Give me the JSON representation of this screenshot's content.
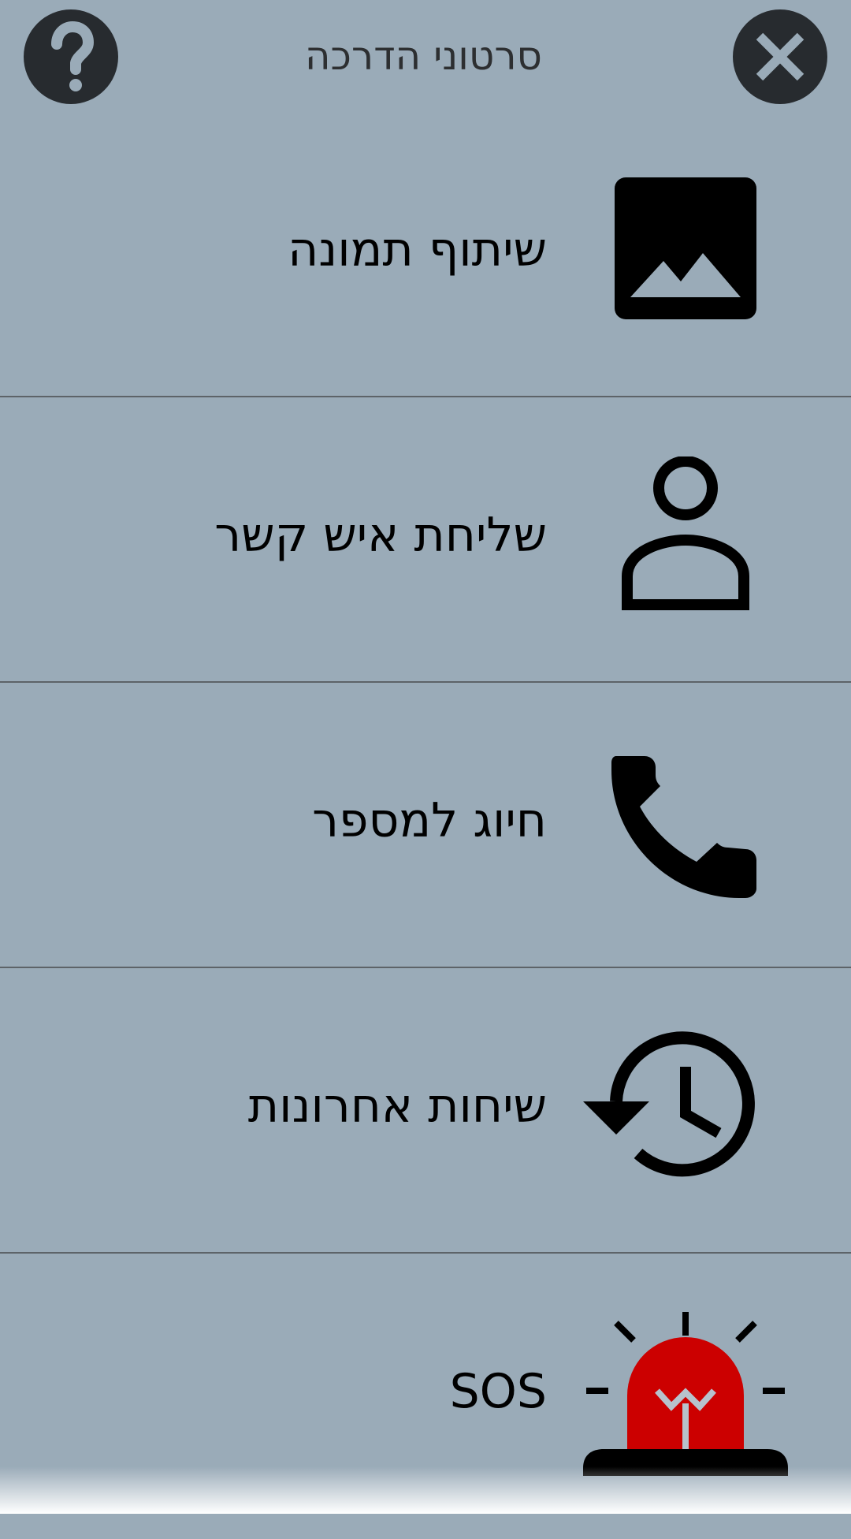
{
  "header": {
    "title": "סרטוני הדרכה",
    "help_icon": "question-mark-icon",
    "close_icon": "close-icon"
  },
  "menu": {
    "items": [
      {
        "label": "שיתוף תמונה",
        "icon": "image-icon"
      },
      {
        "label": "שליחת איש קשר",
        "icon": "contact-icon"
      },
      {
        "label": "חיוג למספר",
        "icon": "phone-icon"
      },
      {
        "label": "שיחות אחרונות",
        "icon": "history-icon"
      },
      {
        "label": "SOS",
        "icon": "siren-icon"
      }
    ]
  },
  "colors": {
    "background": "#9aabb8",
    "button": "#272b2f",
    "divider": "#5d6368",
    "siren_red": "#cc0000"
  }
}
